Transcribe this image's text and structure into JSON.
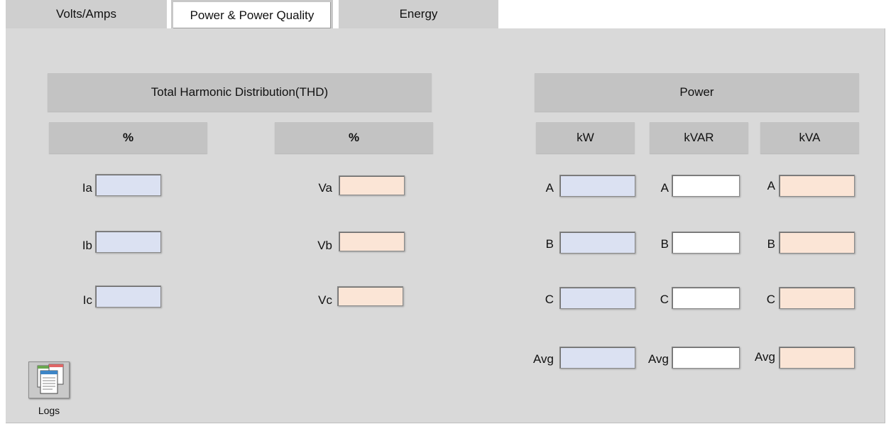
{
  "tabs": [
    {
      "label": "Volts/Amps",
      "active": false
    },
    {
      "label": "Power & Power Quality",
      "active": true
    },
    {
      "label": "Energy",
      "active": false
    }
  ],
  "thd": {
    "title": "Total Harmonic Distribution(THD)",
    "current_unit": "%",
    "voltage_unit": "%",
    "currents": [
      {
        "label": "Ia",
        "value": ""
      },
      {
        "label": "Ib",
        "value": ""
      },
      {
        "label": "Ic",
        "value": ""
      }
    ],
    "voltages": [
      {
        "label": "Va",
        "value": ""
      },
      {
        "label": "Vb",
        "value": ""
      },
      {
        "label": "Vc",
        "value": ""
      }
    ]
  },
  "power": {
    "title": "Power",
    "columns": [
      "kW",
      "kVAR",
      "kVA"
    ],
    "rows": [
      {
        "label": "A",
        "kw": "",
        "kvar": "",
        "kva": ""
      },
      {
        "label": "B",
        "kw": "",
        "kvar": "",
        "kva": ""
      },
      {
        "label": "C",
        "kw": "",
        "kvar": "",
        "kva": ""
      },
      {
        "label": "Avg",
        "kw": "",
        "kvar": "",
        "kva": ""
      }
    ]
  },
  "logs": {
    "label": "Logs",
    "icon": "logs-icon"
  },
  "colors": {
    "panel": "#d9d9d9",
    "header": "#c3c3c3",
    "current_field": "#dbe1f2",
    "voltage_field": "#fbe5d6",
    "kvar_field": "#ffffff"
  }
}
